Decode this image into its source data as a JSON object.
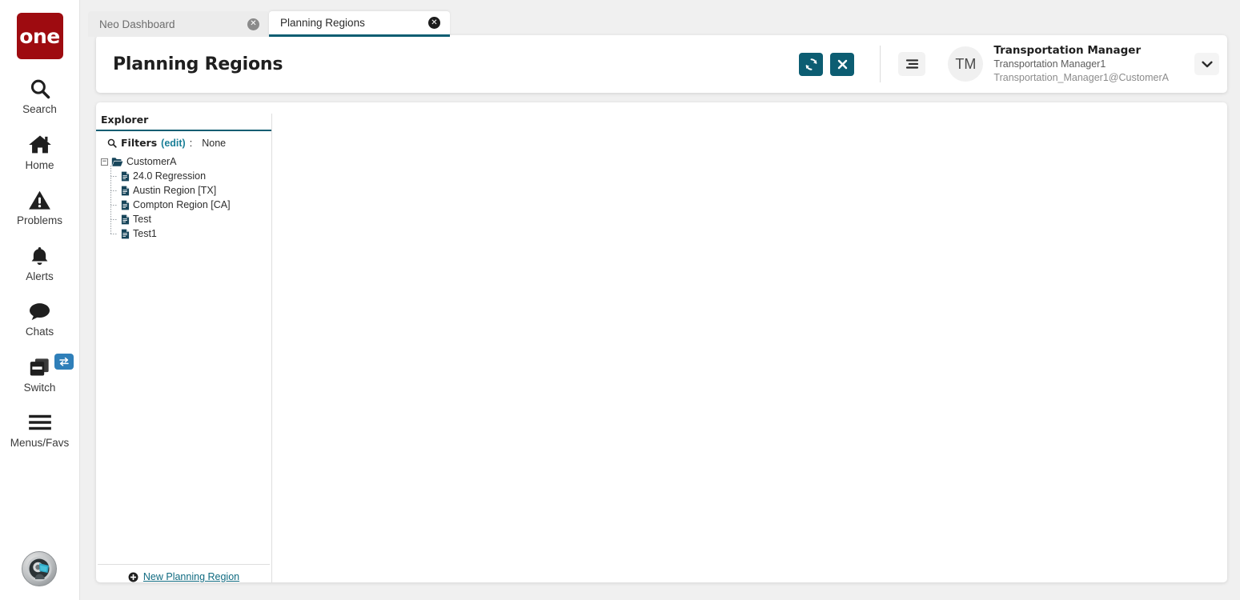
{
  "brand": {
    "logo_text": "one"
  },
  "rail": {
    "items": [
      {
        "label": "Search",
        "icon": "search-icon"
      },
      {
        "label": "Home",
        "icon": "home-icon"
      },
      {
        "label": "Problems",
        "icon": "warning-triangle-icon"
      },
      {
        "label": "Alerts",
        "icon": "bell-icon"
      },
      {
        "label": "Chats",
        "icon": "chat-bubble-icon"
      },
      {
        "label": "Switch",
        "icon": "windows-stack-icon",
        "badge_icon": "swap-arrows-icon"
      },
      {
        "label": "Menus/Favs",
        "icon": "hamburger-icon"
      }
    ],
    "avatar_icon": "profile-head-avatar-icon"
  },
  "tabs": [
    {
      "label": "Neo Dashboard",
      "active": false,
      "close_icon": "close-circle-icon"
    },
    {
      "label": "Planning Regions",
      "active": true,
      "close_icon": "close-circle-icon"
    }
  ],
  "header": {
    "title": "Planning Regions",
    "refresh_icon": "refresh-icon",
    "close_icon": "x-icon",
    "menu_icon": "list-menu-icon",
    "caret_icon": "chevron-down-icon",
    "user": {
      "initials": "TM",
      "name": "Transportation Manager",
      "role": "Transportation Manager1",
      "email": "Transportation_Manager1@CustomerA"
    }
  },
  "explorer": {
    "title": "Explorer",
    "filters": {
      "search_icon": "search-icon",
      "label": "Filters",
      "edit_label": "(edit)",
      "colon": ":",
      "value": "None"
    },
    "tree": {
      "expander": "−",
      "root": {
        "label": "CustomerA",
        "icon": "folder-open-icon"
      },
      "children": [
        {
          "label": "24.0 Regression",
          "icon": "document-icon"
        },
        {
          "label": "Austin Region [TX]",
          "icon": "document-icon"
        },
        {
          "label": "Compton Region [CA]",
          "icon": "document-icon"
        },
        {
          "label": "Test",
          "icon": "document-icon"
        },
        {
          "label": "Test1",
          "icon": "document-icon"
        }
      ]
    },
    "footer": {
      "add_icon": "plus-circle-icon",
      "link_label": "New Planning Region"
    }
  },
  "colors": {
    "brand_red": "#9e0b10",
    "teal": "#0c5d72",
    "link_teal": "#0f6a80",
    "badge_blue": "#2f7fb9",
    "page_bg": "#f0f0f0",
    "tree_icon": "#17455a"
  }
}
